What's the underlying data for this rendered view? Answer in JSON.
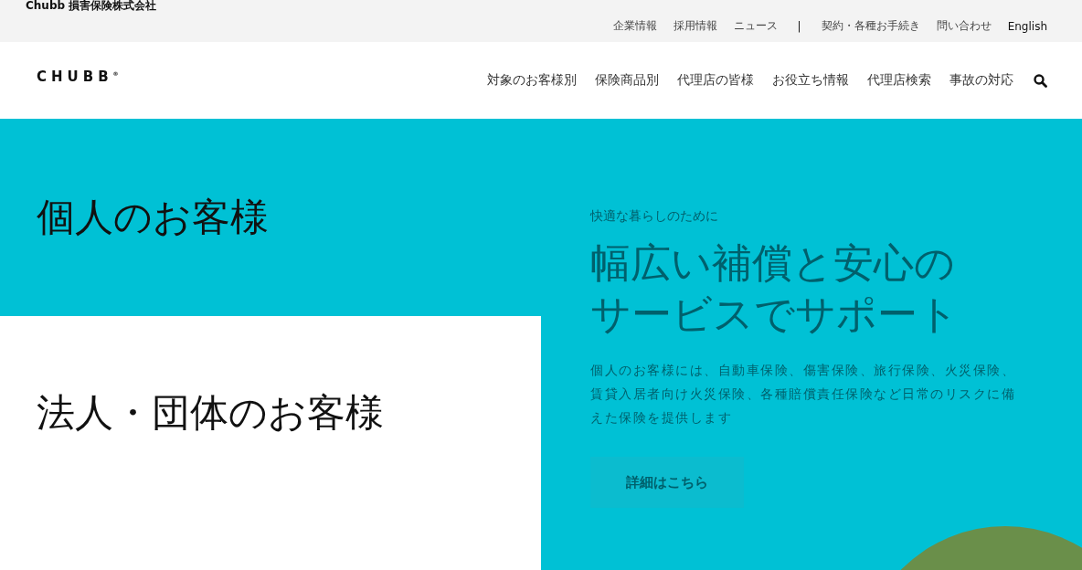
{
  "top_bar": {
    "company": "Chubb 損害保険株式会社",
    "links": [
      "企業情報",
      "採用情報",
      "ニュース"
    ],
    "separator": "|",
    "links_right": [
      "契約・各種お手続き",
      "問い合わせ",
      "English"
    ]
  },
  "header": {
    "logo": "CHUBB$^{®}$",
    "nav": [
      "対象のお客様別",
      "保険商品別",
      "代理店の皆様",
      "お役立ち情報",
      "代理店検索",
      "事故の対応"
    ]
  },
  "segments": [
    {
      "label": "個人のお客様",
      "selected": true
    },
    {
      "label": "法人・団体のお客様",
      "selected": false
    }
  ],
  "feature": {
    "eyebrow": "快適な暮らしのために",
    "heading": "幅広い補償と安心のサービスでサポート",
    "body": "個人のお客様には、自動車保険、傷害保険、旅行保険、火災保険、賃貸入居者向け火災保険、各種賠償責任保険など日常のリスクに備えた保険を提供します",
    "button": "詳細はこちら"
  }
}
